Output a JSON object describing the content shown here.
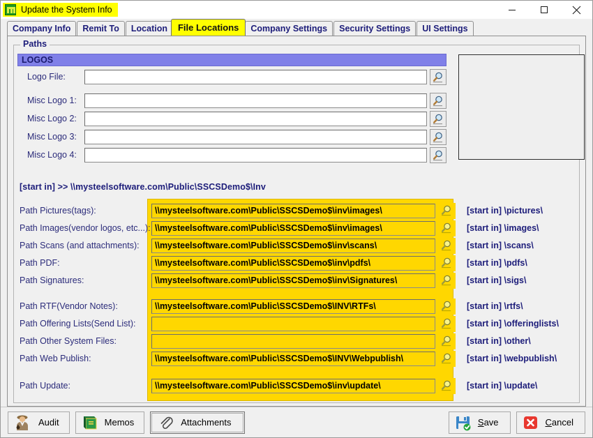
{
  "window": {
    "title": "Update the System Info",
    "app_icon": "green-grid-icon",
    "controls": {
      "minimize": "minimize-icon",
      "maximize": "maximize-icon",
      "close": "close-icon"
    }
  },
  "tabs": [
    {
      "label": "Company Info",
      "active": false
    },
    {
      "label": "Remit To",
      "active": false
    },
    {
      "label": "Location",
      "active": false
    },
    {
      "label": "File Locations",
      "active": true
    },
    {
      "label": "Company Settings",
      "active": false
    },
    {
      "label": "Security Settings",
      "active": false
    },
    {
      "label": "UI Settings",
      "active": false
    }
  ],
  "group": {
    "legend": "Paths"
  },
  "logos": {
    "header": "LOGOS",
    "rows": [
      {
        "label": "Logo File:",
        "value": ""
      },
      {
        "label": "Misc Logo 1:",
        "value": ""
      },
      {
        "label": "Misc Logo 2:",
        "value": ""
      },
      {
        "label": "Misc Logo 3:",
        "value": ""
      },
      {
        "label": "Misc Logo 4:",
        "value": ""
      }
    ]
  },
  "start_in_line": "[start in]  >> \\\\mysteelsoftware.com\\Public\\SSCSDemo$\\Inv",
  "paths": [
    {
      "label": "Path Pictures(tags):",
      "value": "\\\\mysteelsoftware.com\\Public\\SSCSDemo$\\inv\\images\\",
      "hint": "[start in] \\pictures\\"
    },
    {
      "label": "Path Images(vendor logos, etc...):",
      "value": "\\\\mysteelsoftware.com\\Public\\SSCSDemo$\\inv\\images\\",
      "hint": "[start in] \\images\\"
    },
    {
      "label": "Path Scans (and attachments):",
      "value": "\\\\mysteelsoftware.com\\Public\\SSCSDemo$\\inv\\scans\\",
      "hint": "[start in] \\scans\\"
    },
    {
      "label": "Path PDF:",
      "value": "\\\\mysteelsoftware.com\\Public\\SSCSDemo$\\inv\\pdfs\\",
      "hint": "[start in] \\pdfs\\"
    },
    {
      "label": "Path Signatures:",
      "value": "\\\\mysteelsoftware.com\\Public\\SSCSDemo$\\inv\\Signatures\\",
      "hint": "[start in] \\sigs\\"
    },
    {
      "label": "Path RTF(Vendor Notes):",
      "value": "\\\\mysteelsoftware.com\\Public\\SSCSDemo$\\INV\\RTFs\\",
      "hint": "[start in] \\rtfs\\"
    },
    {
      "label": "Path Offering Lists(Send List):",
      "value": "",
      "hint": "[start in] \\offeringlists\\"
    },
    {
      "label": "Path Other System Files:",
      "value": "",
      "hint": "[start in] \\other\\"
    },
    {
      "label": "Path Web Publish:",
      "value": "\\\\mysteelsoftware.com\\Public\\SSCSDemo$\\INV\\Webpublish\\",
      "hint": "[start in] \\webpublish\\"
    },
    {
      "label": "Path Update:",
      "value": "\\\\mysteelsoftware.com\\Public\\SSCSDemo$\\inv\\update\\",
      "hint": "[start in] \\update\\"
    }
  ],
  "toolbar": {
    "audit": "Audit",
    "memos": "Memos",
    "attachments": "Attachments",
    "save": "Save",
    "cancel": "Cancel"
  },
  "colors": {
    "highlight_yellow": "#ffff00",
    "field_yellow": "#ffd700",
    "logos_header": "#8080e8",
    "label_blue": "#2b2b7a",
    "save_green": "#22a53a",
    "cancel_red": "#e8382f"
  }
}
